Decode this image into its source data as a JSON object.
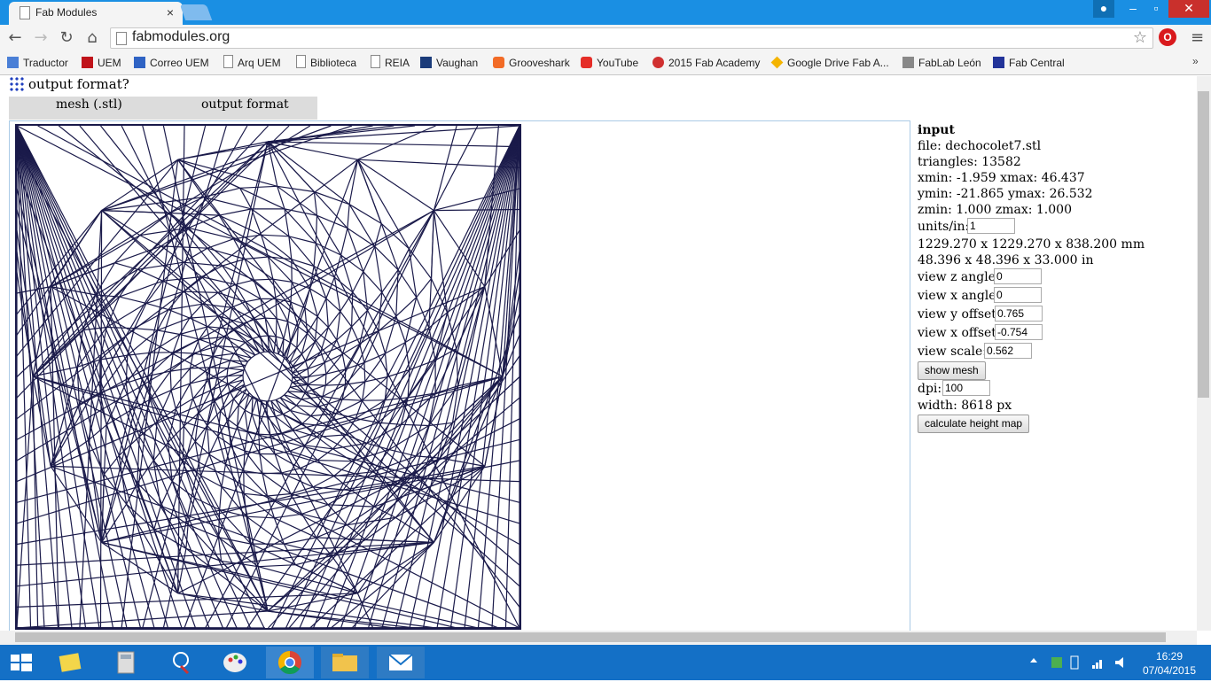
{
  "browser": {
    "tab_title": "Fab Modules",
    "url": "fabmodules.org",
    "bookmarks": [
      {
        "label": "Traductor",
        "color": "#4a7fd6"
      },
      {
        "label": "UEM",
        "color": "#c0131a"
      },
      {
        "label": "Correo UEM",
        "color": "#2f63c4"
      },
      {
        "label": "Arq UEM",
        "color": "#ffffff"
      },
      {
        "label": "Biblioteca",
        "color": "#ffffff"
      },
      {
        "label": "REIA",
        "color": "#ffffff"
      },
      {
        "label": "Vaughan",
        "color": "#1a3b7a"
      },
      {
        "label": "Grooveshark",
        "color": "#f26b26"
      },
      {
        "label": "YouTube",
        "color": "#e52d27"
      },
      {
        "label": "2015 Fab Academy",
        "color": "#d03030"
      },
      {
        "label": "Google Drive Fab A...",
        "color": "#f4b400"
      },
      {
        "label": "FabLab León",
        "color": "#888888"
      },
      {
        "label": "Fab Central",
        "color": "#223399"
      }
    ]
  },
  "page": {
    "heading": "output format?",
    "format_options": [
      "mesh (.stl)",
      "output format"
    ]
  },
  "panel": {
    "title": "input",
    "file": "file: dechocolet7.stl",
    "triangles": "triangles: 13582",
    "xrange": "xmin: -1.959 xmax: 46.437",
    "yrange": "ymin: -21.865 ymax: 26.532",
    "zrange": "zmin: 1.000 zmax: 1.000",
    "units_label": "units/in:",
    "units_value": "1",
    "size_mm": "1229.270 x 1229.270 x 838.200 mm",
    "size_in": "48.396 x 48.396 x 33.000 in",
    "view_z_angle_label": "view z angle:",
    "view_z_angle_value": "0",
    "view_x_angle_label": "view x angle:",
    "view_x_angle_value": "0",
    "view_y_offset_label": "view y offset:",
    "view_y_offset_value": "0.765",
    "view_x_offset_label": "view x offset:",
    "view_x_offset_value": "-0.754",
    "view_scale_label": "view scale:",
    "view_scale_value": "0.562",
    "show_mesh_button": "show mesh",
    "dpi_label": "dpi:",
    "dpi_value": "100",
    "width": "width: 8618 px",
    "calc_button": "calculate height map"
  },
  "taskbar": {
    "time": "16:29",
    "date": "07/04/2015"
  },
  "colors": {
    "titlebar": "#1a8fe3",
    "mesh_stroke": "#1a1a4a",
    "taskbar": "#1470c6"
  }
}
